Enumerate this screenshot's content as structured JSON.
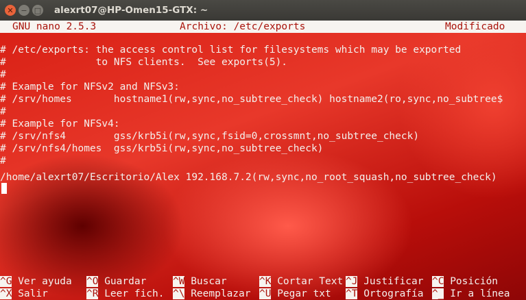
{
  "window": {
    "title": "alexrt07@HP-Omen15-GTX: ~",
    "buttons": {
      "close": "✕",
      "minimize": "−",
      "maximize": "□"
    }
  },
  "nano": {
    "version": "GNU nano 2.5.3",
    "file": "Archivo: /etc/exports",
    "status": "Modificado"
  },
  "content_lines": [
    "# /etc/exports: the access control list for filesystems which may be exported",
    "#               to NFS clients.  See exports(5).",
    "#",
    "# Example for NFSv2 and NFSv3:",
    "# /srv/homes       hostname1(rw,sync,no_subtree_check) hostname2(ro,sync,no_subtree$",
    "#",
    "# Example for NFSv4:",
    "# /srv/nfs4        gss/krb5i(rw,sync,fsid=0,crossmnt,no_subtree_check)",
    "# /srv/nfs4/homes  gss/krb5i(rw,sync,no_subtree_check)",
    "#",
    "",
    "/home/alexrt07/Escritorio/Alex 192.168.7.2(rw,sync,no_root_squash,no_subtree_check)"
  ],
  "shortcuts": [
    {
      "key": "^G",
      "label": " Ver ayuda"
    },
    {
      "key": "^O",
      "label": " Guardar"
    },
    {
      "key": "^W",
      "label": " Buscar"
    },
    {
      "key": "^K",
      "label": " Cortar Text"
    },
    {
      "key": "^J",
      "label": " Justificar"
    },
    {
      "key": "^C",
      "label": " Posición"
    },
    {
      "key": "^X",
      "label": " Salir"
    },
    {
      "key": "^R",
      "label": " Leer fich."
    },
    {
      "key": "^\\",
      "label": " Reemplazar"
    },
    {
      "key": "^U",
      "label": " Pegar txt"
    },
    {
      "key": "^T",
      "label": " Ortografía"
    },
    {
      "key": "^_",
      "label": " Ir a línea"
    }
  ]
}
